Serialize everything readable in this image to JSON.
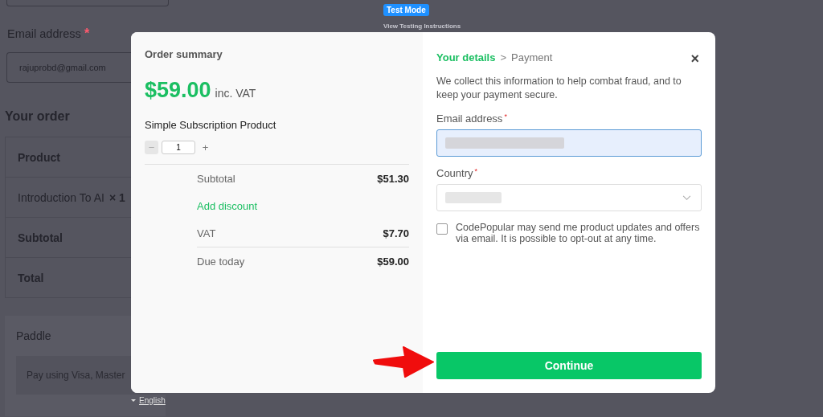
{
  "background_page": {
    "email_label": "Email address",
    "email_required_mark": "*",
    "email_value": "rajuprobd@gmail.com",
    "order_heading": "Your order",
    "order_rows": [
      {
        "kind": "header",
        "label": "Product"
      },
      {
        "kind": "item",
        "label": "Introduction To AI",
        "qty": "× 1"
      },
      {
        "kind": "header",
        "label": "Subtotal"
      },
      {
        "kind": "header",
        "label": "Total"
      }
    ],
    "payment_method": {
      "name": "Paddle",
      "description": "Pay using Visa, Master"
    }
  },
  "test_mode": {
    "badge": "Test Mode",
    "link": "View Testing Instructions"
  },
  "checkout": {
    "summary": {
      "title": "Order summary",
      "price": "$59.00",
      "price_suffix": "inc. VAT",
      "product": "Simple Subscription Product",
      "minus": "−",
      "quantity": "1",
      "plus": "+",
      "lines": [
        {
          "kind": "amount",
          "label": "Subtotal",
          "value": "$51.30"
        },
        {
          "kind": "link",
          "label": "Add discount"
        },
        {
          "kind": "amount",
          "label": "VAT",
          "value": "$7.70"
        },
        {
          "kind": "total",
          "label": "Due today",
          "value": "$59.00"
        }
      ]
    },
    "details": {
      "steps": [
        {
          "label": "Your details",
          "selected": true
        },
        {
          "label": "Payment",
          "selected": false
        }
      ],
      "step_separator": ">",
      "close": "×",
      "intro": "We collect this information to help combat fraud, and to keep your payment secure.",
      "fields": [
        {
          "kind": "text",
          "label": "Email address",
          "required_mark": "*",
          "focused": true
        },
        {
          "kind": "select",
          "label": "Country",
          "required_mark": "*",
          "focused": false
        }
      ],
      "consent": {
        "label": "CodePopular may send me product updates and offers via email. It is possible to opt-out at any time.",
        "checked": false
      },
      "button": "Continue"
    },
    "language": "English"
  }
}
